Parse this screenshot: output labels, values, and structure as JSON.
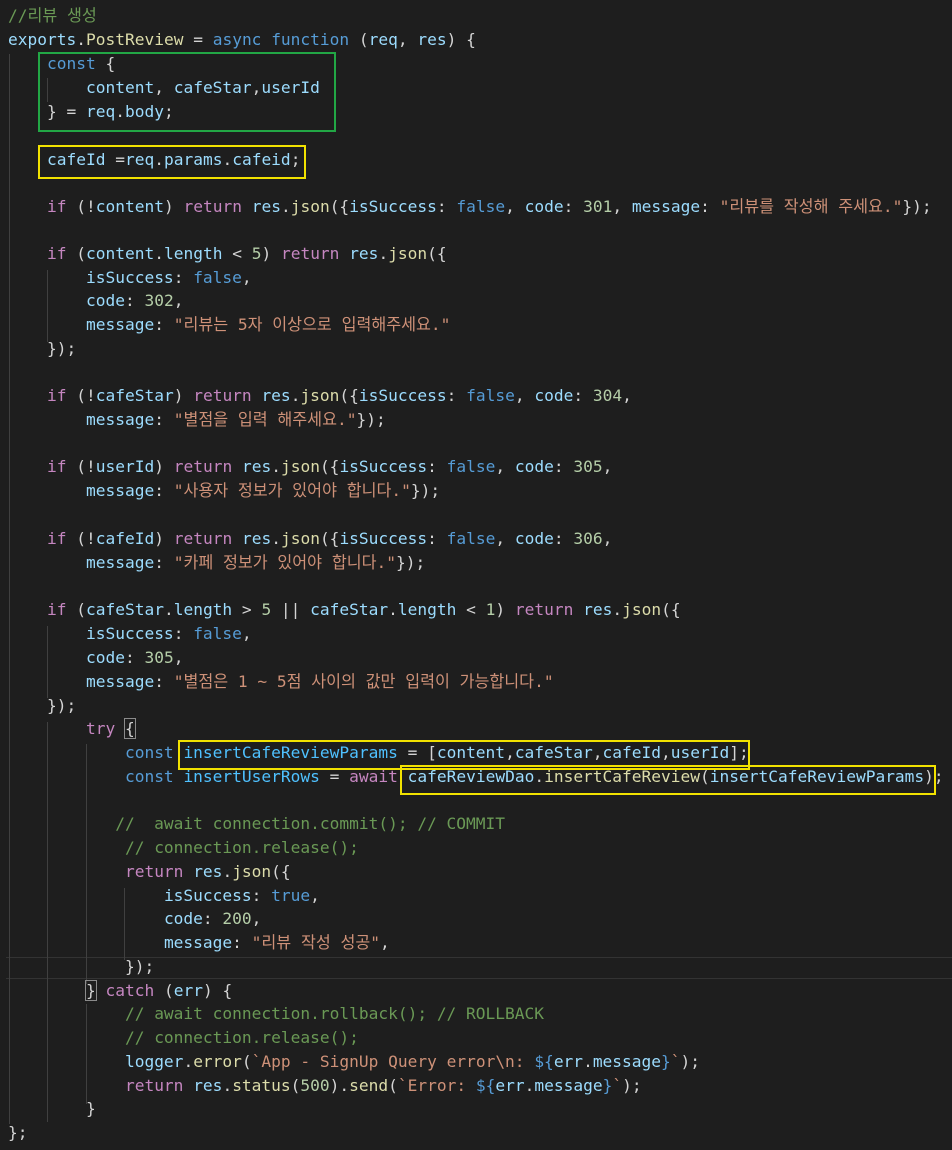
{
  "colors": {
    "background": "#1e1e1e",
    "comment": "#6a9955",
    "keyword_blue": "#569cd6",
    "control_purple": "#c586c0",
    "variable": "#9cdcfe",
    "function": "#dcdcaa",
    "string": "#ce9178",
    "number": "#b5cea8",
    "plain": "#d4d4d4",
    "constant": "#4fc1ff",
    "highlight_green": "#22a745",
    "highlight_yellow": "#f2e200"
  },
  "lines": [
    [
      [
        "c",
        "//리뷰 생성"
      ]
    ],
    [
      [
        "v",
        "exports"
      ],
      [
        "p",
        "."
      ],
      [
        "f",
        "PostReview"
      ],
      [
        "p",
        " = "
      ],
      [
        "k",
        "async"
      ],
      [
        "p",
        " "
      ],
      [
        "k",
        "function"
      ],
      [
        "p",
        " ("
      ],
      [
        "v",
        "req"
      ],
      [
        "p",
        ", "
      ],
      [
        "v",
        "res"
      ],
      [
        "p",
        ") {"
      ]
    ],
    [
      [
        "p",
        "    "
      ],
      [
        "k",
        "const"
      ],
      [
        "p",
        " {"
      ]
    ],
    [
      [
        "p",
        "        "
      ],
      [
        "v",
        "content"
      ],
      [
        "p",
        ", "
      ],
      [
        "v",
        "cafeStar"
      ],
      [
        "p",
        ","
      ],
      [
        "v",
        "userId"
      ]
    ],
    [
      [
        "p",
        "    } = "
      ],
      [
        "v",
        "req"
      ],
      [
        "p",
        "."
      ],
      [
        "v",
        "body"
      ],
      [
        "p",
        ";"
      ]
    ],
    [],
    [
      [
        "p",
        "    "
      ],
      [
        "v",
        "cafeId"
      ],
      [
        "p",
        " ="
      ],
      [
        "v",
        "req"
      ],
      [
        "p",
        "."
      ],
      [
        "v",
        "params"
      ],
      [
        "p",
        "."
      ],
      [
        "v",
        "cafeid"
      ],
      [
        "p",
        ";"
      ]
    ],
    [],
    [
      [
        "p",
        "    "
      ],
      [
        "ctl",
        "if"
      ],
      [
        "p",
        " (!"
      ],
      [
        "v",
        "content"
      ],
      [
        "p",
        ") "
      ],
      [
        "ctl",
        "return"
      ],
      [
        "p",
        " "
      ],
      [
        "v",
        "res"
      ],
      [
        "p",
        "."
      ],
      [
        "f",
        "json"
      ],
      [
        "p",
        "({"
      ],
      [
        "v",
        "isSuccess"
      ],
      [
        "p",
        ": "
      ],
      [
        "k",
        "false"
      ],
      [
        "p",
        ", "
      ],
      [
        "v",
        "code"
      ],
      [
        "p",
        ": "
      ],
      [
        "n",
        "301"
      ],
      [
        "p",
        ", "
      ],
      [
        "v",
        "message"
      ],
      [
        "p",
        ": "
      ],
      [
        "s",
        "\"리뷰를 작성해 주세요.\""
      ],
      [
        "p",
        "});"
      ]
    ],
    [],
    [
      [
        "p",
        "    "
      ],
      [
        "ctl",
        "if"
      ],
      [
        "p",
        " ("
      ],
      [
        "v",
        "content"
      ],
      [
        "p",
        "."
      ],
      [
        "v",
        "length"
      ],
      [
        "p",
        " < "
      ],
      [
        "n",
        "5"
      ],
      [
        "p",
        ") "
      ],
      [
        "ctl",
        "return"
      ],
      [
        "p",
        " "
      ],
      [
        "v",
        "res"
      ],
      [
        "p",
        "."
      ],
      [
        "f",
        "json"
      ],
      [
        "p",
        "({"
      ]
    ],
    [
      [
        "p",
        "        "
      ],
      [
        "v",
        "isSuccess"
      ],
      [
        "p",
        ": "
      ],
      [
        "k",
        "false"
      ],
      [
        "p",
        ","
      ]
    ],
    [
      [
        "p",
        "        "
      ],
      [
        "v",
        "code"
      ],
      [
        "p",
        ": "
      ],
      [
        "n",
        "302"
      ],
      [
        "p",
        ","
      ]
    ],
    [
      [
        "p",
        "        "
      ],
      [
        "v",
        "message"
      ],
      [
        "p",
        ": "
      ],
      [
        "s",
        "\"리뷰는 5자 이상으로 입력해주세요.\""
      ]
    ],
    [
      [
        "p",
        "    });"
      ]
    ],
    [],
    [
      [
        "p",
        "    "
      ],
      [
        "ctl",
        "if"
      ],
      [
        "p",
        " (!"
      ],
      [
        "v",
        "cafeStar"
      ],
      [
        "p",
        ") "
      ],
      [
        "ctl",
        "return"
      ],
      [
        "p",
        " "
      ],
      [
        "v",
        "res"
      ],
      [
        "p",
        "."
      ],
      [
        "f",
        "json"
      ],
      [
        "p",
        "({"
      ],
      [
        "v",
        "isSuccess"
      ],
      [
        "p",
        ": "
      ],
      [
        "k",
        "false"
      ],
      [
        "p",
        ", "
      ],
      [
        "v",
        "code"
      ],
      [
        "p",
        ": "
      ],
      [
        "n",
        "304"
      ],
      [
        "p",
        ","
      ]
    ],
    [
      [
        "p",
        "        "
      ],
      [
        "v",
        "message"
      ],
      [
        "p",
        ": "
      ],
      [
        "s",
        "\"별점을 입력 해주세요.\""
      ],
      [
        "p",
        "});"
      ]
    ],
    [],
    [
      [
        "p",
        "    "
      ],
      [
        "ctl",
        "if"
      ],
      [
        "p",
        " (!"
      ],
      [
        "v",
        "userId"
      ],
      [
        "p",
        ") "
      ],
      [
        "ctl",
        "return"
      ],
      [
        "p",
        " "
      ],
      [
        "v",
        "res"
      ],
      [
        "p",
        "."
      ],
      [
        "f",
        "json"
      ],
      [
        "p",
        "({"
      ],
      [
        "v",
        "isSuccess"
      ],
      [
        "p",
        ": "
      ],
      [
        "k",
        "false"
      ],
      [
        "p",
        ", "
      ],
      [
        "v",
        "code"
      ],
      [
        "p",
        ": "
      ],
      [
        "n",
        "305"
      ],
      [
        "p",
        ","
      ]
    ],
    [
      [
        "p",
        "        "
      ],
      [
        "v",
        "message"
      ],
      [
        "p",
        ": "
      ],
      [
        "s",
        "\"사용자 정보가 있어야 합니다.\""
      ],
      [
        "p",
        "});"
      ]
    ],
    [],
    [
      [
        "p",
        "    "
      ],
      [
        "ctl",
        "if"
      ],
      [
        "p",
        " (!"
      ],
      [
        "v",
        "cafeId"
      ],
      [
        "p",
        ") "
      ],
      [
        "ctl",
        "return"
      ],
      [
        "p",
        " "
      ],
      [
        "v",
        "res"
      ],
      [
        "p",
        "."
      ],
      [
        "f",
        "json"
      ],
      [
        "p",
        "({"
      ],
      [
        "v",
        "isSuccess"
      ],
      [
        "p",
        ": "
      ],
      [
        "k",
        "false"
      ],
      [
        "p",
        ", "
      ],
      [
        "v",
        "code"
      ],
      [
        "p",
        ": "
      ],
      [
        "n",
        "306"
      ],
      [
        "p",
        ","
      ]
    ],
    [
      [
        "p",
        "        "
      ],
      [
        "v",
        "message"
      ],
      [
        "p",
        ": "
      ],
      [
        "s",
        "\"카페 정보가 있어야 합니다.\""
      ],
      [
        "p",
        "});"
      ]
    ],
    [],
    [
      [
        "p",
        "    "
      ],
      [
        "ctl",
        "if"
      ],
      [
        "p",
        " ("
      ],
      [
        "v",
        "cafeStar"
      ],
      [
        "p",
        "."
      ],
      [
        "v",
        "length"
      ],
      [
        "p",
        " > "
      ],
      [
        "n",
        "5"
      ],
      [
        "p",
        " || "
      ],
      [
        "v",
        "cafeStar"
      ],
      [
        "p",
        "."
      ],
      [
        "v",
        "length"
      ],
      [
        "p",
        " < "
      ],
      [
        "n",
        "1"
      ],
      [
        "p",
        ") "
      ],
      [
        "ctl",
        "return"
      ],
      [
        "p",
        " "
      ],
      [
        "v",
        "res"
      ],
      [
        "p",
        "."
      ],
      [
        "f",
        "json"
      ],
      [
        "p",
        "({"
      ]
    ],
    [
      [
        "p",
        "        "
      ],
      [
        "v",
        "isSuccess"
      ],
      [
        "p",
        ": "
      ],
      [
        "k",
        "false"
      ],
      [
        "p",
        ","
      ]
    ],
    [
      [
        "p",
        "        "
      ],
      [
        "v",
        "code"
      ],
      [
        "p",
        ": "
      ],
      [
        "n",
        "305"
      ],
      [
        "p",
        ","
      ]
    ],
    [
      [
        "p",
        "        "
      ],
      [
        "v",
        "message"
      ],
      [
        "p",
        ": "
      ],
      [
        "s",
        "\"별점은 1 ~ 5점 사이의 값만 입력이 가능합니다.\""
      ]
    ],
    [
      [
        "p",
        "    });"
      ]
    ],
    [
      [
        "p",
        "        "
      ],
      [
        "ctl",
        "try"
      ],
      [
        "p",
        " "
      ],
      [
        "pm",
        "{"
      ]
    ],
    [
      [
        "p",
        "            "
      ],
      [
        "k",
        "const"
      ],
      [
        "p",
        " "
      ],
      [
        "cn",
        "insertCafeReviewParams"
      ],
      [
        "p",
        " = ["
      ],
      [
        "v",
        "content"
      ],
      [
        "p",
        ","
      ],
      [
        "v",
        "cafeStar"
      ],
      [
        "p",
        ","
      ],
      [
        "v",
        "cafeId"
      ],
      [
        "p",
        ","
      ],
      [
        "v",
        "userId"
      ],
      [
        "p",
        "];"
      ]
    ],
    [
      [
        "p",
        "            "
      ],
      [
        "k",
        "const"
      ],
      [
        "p",
        " "
      ],
      [
        "cn",
        "insertUserRows"
      ],
      [
        "p",
        " = "
      ],
      [
        "ctl",
        "await"
      ],
      [
        "p",
        " "
      ],
      [
        "v",
        "cafeReviewDao"
      ],
      [
        "p",
        "."
      ],
      [
        "f",
        "insertCafeReview"
      ],
      [
        "p",
        "("
      ],
      [
        "v",
        "insertCafeReviewParams"
      ],
      [
        "p",
        ");"
      ]
    ],
    [],
    [
      [
        "p",
        "           "
      ],
      [
        "c",
        "//  await connection.commit(); // COMMIT"
      ]
    ],
    [
      [
        "p",
        "            "
      ],
      [
        "c",
        "// connection.release();"
      ]
    ],
    [
      [
        "p",
        "            "
      ],
      [
        "ctl",
        "return"
      ],
      [
        "p",
        " "
      ],
      [
        "v",
        "res"
      ],
      [
        "p",
        "."
      ],
      [
        "f",
        "json"
      ],
      [
        "p",
        "({"
      ]
    ],
    [
      [
        "p",
        "                "
      ],
      [
        "v",
        "isSuccess"
      ],
      [
        "p",
        ": "
      ],
      [
        "k",
        "true"
      ],
      [
        "p",
        ","
      ]
    ],
    [
      [
        "p",
        "                "
      ],
      [
        "v",
        "code"
      ],
      [
        "p",
        ": "
      ],
      [
        "n",
        "200"
      ],
      [
        "p",
        ","
      ]
    ],
    [
      [
        "p",
        "                "
      ],
      [
        "v",
        "message"
      ],
      [
        "p",
        ": "
      ],
      [
        "s",
        "\"리뷰 작성 성공\""
      ],
      [
        "p",
        ","
      ]
    ],
    [
      [
        "p",
        "            });"
      ]
    ],
    [
      [
        "p",
        "        "
      ],
      [
        "pm",
        "}"
      ],
      [
        "p",
        " "
      ],
      [
        "ctl",
        "catch"
      ],
      [
        "p",
        " ("
      ],
      [
        "v",
        "err"
      ],
      [
        "p",
        ") {"
      ]
    ],
    [
      [
        "p",
        "            "
      ],
      [
        "c",
        "// await connection.rollback(); // ROLLBACK"
      ]
    ],
    [
      [
        "p",
        "            "
      ],
      [
        "c",
        "// connection.release();"
      ]
    ],
    [
      [
        "p",
        "            "
      ],
      [
        "v",
        "logger"
      ],
      [
        "p",
        "."
      ],
      [
        "f",
        "error"
      ],
      [
        "p",
        "("
      ],
      [
        "s",
        "`App - SignUp Query error\\n: "
      ],
      [
        "k",
        "${"
      ],
      [
        "v",
        "err"
      ],
      [
        "p",
        "."
      ],
      [
        "v",
        "message"
      ],
      [
        "k",
        "}"
      ],
      [
        "s",
        "`"
      ],
      [
        "p",
        ");"
      ]
    ],
    [
      [
        "p",
        "            "
      ],
      [
        "ctl",
        "return"
      ],
      [
        "p",
        " "
      ],
      [
        "v",
        "res"
      ],
      [
        "p",
        "."
      ],
      [
        "f",
        "status"
      ],
      [
        "p",
        "("
      ],
      [
        "n",
        "500"
      ],
      [
        "p",
        ")."
      ],
      [
        "f",
        "send"
      ],
      [
        "p",
        "("
      ],
      [
        "s",
        "`Error: "
      ],
      [
        "k",
        "${"
      ],
      [
        "v",
        "err"
      ],
      [
        "p",
        "."
      ],
      [
        "v",
        "message"
      ],
      [
        "k",
        "}"
      ],
      [
        "s",
        "`"
      ],
      [
        "p",
        ");"
      ]
    ],
    [
      [
        "p",
        "        }"
      ]
    ],
    [
      [
        "p",
        "};"
      ]
    ]
  ]
}
